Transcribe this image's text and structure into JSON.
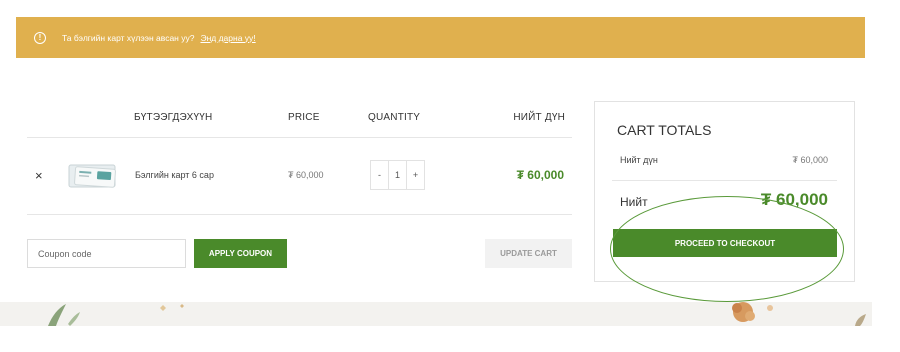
{
  "notice": {
    "icon": "info-icon",
    "text": "Та бэлгийн карт хүлээн авсан уу?",
    "link": "Энд дарна уу!"
  },
  "cart_table": {
    "headers": {
      "product": "БҮТЭЭГДЭХҮҮН",
      "price": "PRICE",
      "quantity": "QUANTITY",
      "subtotal": "НИЙТ ДҮН"
    },
    "items": [
      {
        "remove": "×",
        "name": "Бэлгийн карт 6 сар",
        "price": "₮ 60,000",
        "quantity": "1",
        "minus": "-",
        "plus": "+",
        "subtotal": "₮ 60,000"
      }
    ],
    "coupon_placeholder": "Coupon code",
    "apply_coupon": "APPLY COUPON",
    "update_cart": "UPDATE CART"
  },
  "cart_totals": {
    "title": "CART TOTALS",
    "subtotal_label": "Нийт дүн",
    "subtotal_value": "₮ 60,000",
    "total_label": "Нийт",
    "total_value": "₮ 60,000",
    "checkout": "PROCEED TO CHECKOUT"
  },
  "colors": {
    "notice_bg": "#e0b04e",
    "accent_green": "#4a8a2a"
  }
}
